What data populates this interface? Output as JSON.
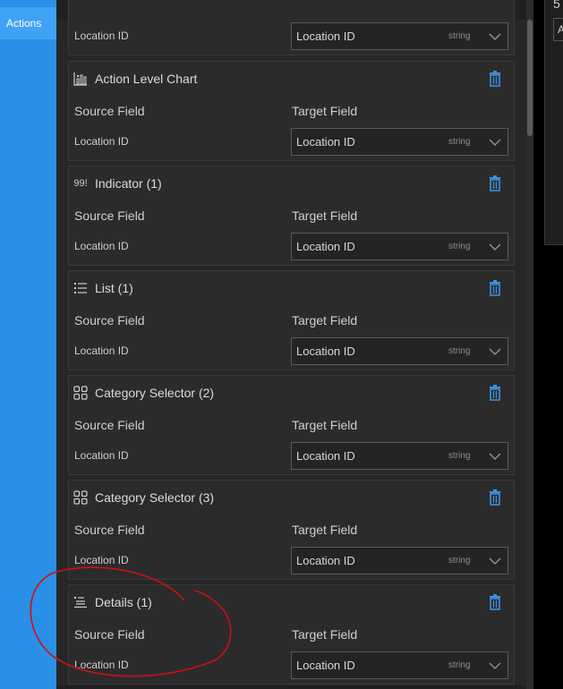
{
  "sidebar": {
    "tab_label": "Actions"
  },
  "side_panel": {
    "glyph_top": "5",
    "input_text": "A"
  },
  "cards_partial": {
    "field": "Location ID",
    "target": {
      "value": "Location ID",
      "type": "string"
    }
  },
  "cards": [
    {
      "title": "Action Level Chart",
      "icon": "bar-chart-icon",
      "source_label": "Source Field",
      "target_label": "Target Field",
      "field": "Location ID",
      "target": {
        "value": "Location ID",
        "type": "string"
      }
    },
    {
      "title": "Indicator (1)",
      "icon": "indicator-icon",
      "icon_text": "99!",
      "source_label": "Source Field",
      "target_label": "Target Field",
      "field": "Location ID",
      "target": {
        "value": "Location ID",
        "type": "string"
      }
    },
    {
      "title": "List (1)",
      "icon": "list-icon",
      "source_label": "Source Field",
      "target_label": "Target Field",
      "field": "Location ID",
      "target": {
        "value": "Location ID",
        "type": "string"
      }
    },
    {
      "title": "Category Selector (2)",
      "icon": "category-selector-icon",
      "source_label": "Source Field",
      "target_label": "Target Field",
      "field": "Location ID",
      "target": {
        "value": "Location ID",
        "type": "string"
      }
    },
    {
      "title": "Category Selector (3)",
      "icon": "category-selector-icon",
      "source_label": "Source Field",
      "target_label": "Target Field",
      "field": "Location ID",
      "target": {
        "value": "Location ID",
        "type": "string"
      }
    },
    {
      "title": "Details (1)",
      "icon": "details-icon",
      "source_label": "Source Field",
      "target_label": "Target Field",
      "field": "Location ID",
      "target": {
        "value": "Location ID",
        "type": "string"
      }
    }
  ],
  "colors": {
    "accent": "#2a8fe6",
    "trash": "#3d8fdd",
    "annotation": "#d01010"
  }
}
